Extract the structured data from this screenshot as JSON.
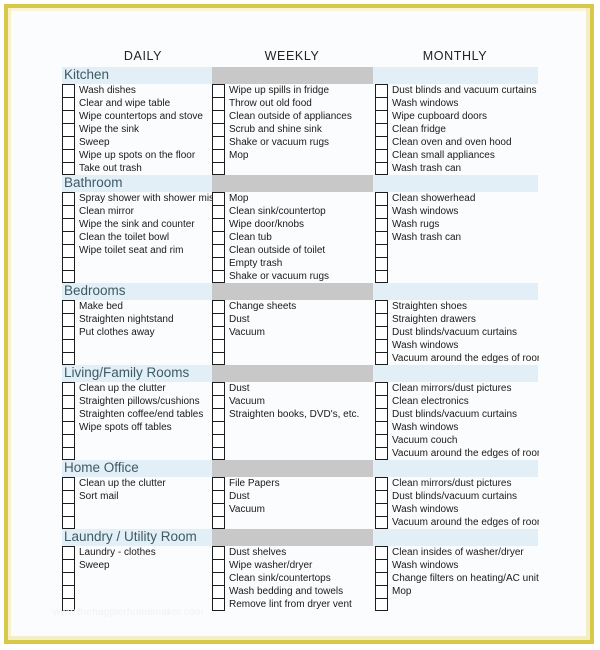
{
  "document": {
    "watermark": "www.thehappierhomemaker.com",
    "colors": {
      "frame": "#d8c84a",
      "section_band_blue": "#e3eff6",
      "section_band_gray": "#c8c8c8",
      "section_title": "#3d5a66",
      "text": "#1a1a1a"
    }
  },
  "columns": [
    {
      "label": "DAILY"
    },
    {
      "label": "WEEKLY"
    },
    {
      "label": "MONTHLY"
    }
  ],
  "sections": [
    {
      "title": "Kitchen",
      "daily": [
        "Wash dishes",
        "Clear and wipe table",
        "Wipe countertops and stove",
        "Wipe the sink",
        "Sweep",
        "Wipe up spots on the floor",
        "Take out trash"
      ],
      "weekly": [
        "Wipe up spills in fridge",
        "Throw out old food",
        "Clean outside of appliances",
        "Scrub and shine sink",
        "Shake or vacuum rugs",
        "Mop",
        ""
      ],
      "monthly": [
        "Dust blinds and vacuum curtains",
        "Wash windows",
        "Wipe cupboard doors",
        "Clean fridge",
        "Clean oven and oven hood",
        "Clean small appliances",
        "Wash trash can"
      ]
    },
    {
      "title": "Bathroom",
      "daily": [
        "Spray shower with shower mist",
        "Clean mirror",
        "Wipe the sink and counter",
        "Clean the toilet bowl",
        "Wipe toilet seat and rim",
        "",
        ""
      ],
      "weekly": [
        "Mop",
        "Clean sink/countertop",
        "Wipe door/knobs",
        "Clean tub",
        "Clean outside of toilet",
        "Empty trash",
        "Shake or vacuum rugs"
      ],
      "monthly": [
        "Clean showerhead",
        "Wash windows",
        "Wash rugs",
        "Wash trash can",
        "",
        "",
        ""
      ]
    },
    {
      "title": "Bedrooms",
      "daily": [
        "Make bed",
        "Straighten nightstand",
        "Put clothes away",
        "",
        ""
      ],
      "weekly": [
        "Change sheets",
        "Dust",
        "Vacuum",
        "",
        ""
      ],
      "monthly": [
        "Straighten shoes",
        "Straighten drawers",
        "Dust blinds/vacuum curtains",
        "Wash windows",
        "Vacuum around the edges of room"
      ]
    },
    {
      "title": "Living/Family Rooms",
      "daily": [
        "Clean up the clutter",
        "Straighten pillows/cushions",
        "Straighten coffee/end tables",
        "Wipe spots off tables",
        "",
        ""
      ],
      "weekly": [
        "Dust",
        "Vacuum",
        "Straighten books, DVD's, etc.",
        "",
        "",
        ""
      ],
      "monthly": [
        "Clean mirrors/dust pictures",
        "Clean electronics",
        "Dust blinds/vacuum curtains",
        "Wash windows",
        "Vacuum couch",
        "Vacuum around the edges of room"
      ]
    },
    {
      "title": "Home Office",
      "daily": [
        "Clean up the clutter",
        "Sort mail",
        "",
        ""
      ],
      "weekly": [
        "File Papers",
        "Dust",
        "Vacuum",
        ""
      ],
      "monthly": [
        "Clean mirrors/dust pictures",
        "Dust blinds/vacuum curtains",
        "Wash windows",
        "Vacuum around the edges of room"
      ]
    },
    {
      "title": "Laundry / Utility Room",
      "daily": [
        "Laundry - clothes",
        "Sweep",
        "",
        "",
        ""
      ],
      "weekly": [
        "Dust shelves",
        "Wipe washer/dryer",
        "Clean sink/countertops",
        "Wash bedding and towels",
        "Remove lint from dryer vent"
      ],
      "monthly": [
        "Clean insides of washer/dryer",
        "Wash windows",
        "Change filters on heating/AC units",
        "Mop",
        ""
      ]
    }
  ]
}
